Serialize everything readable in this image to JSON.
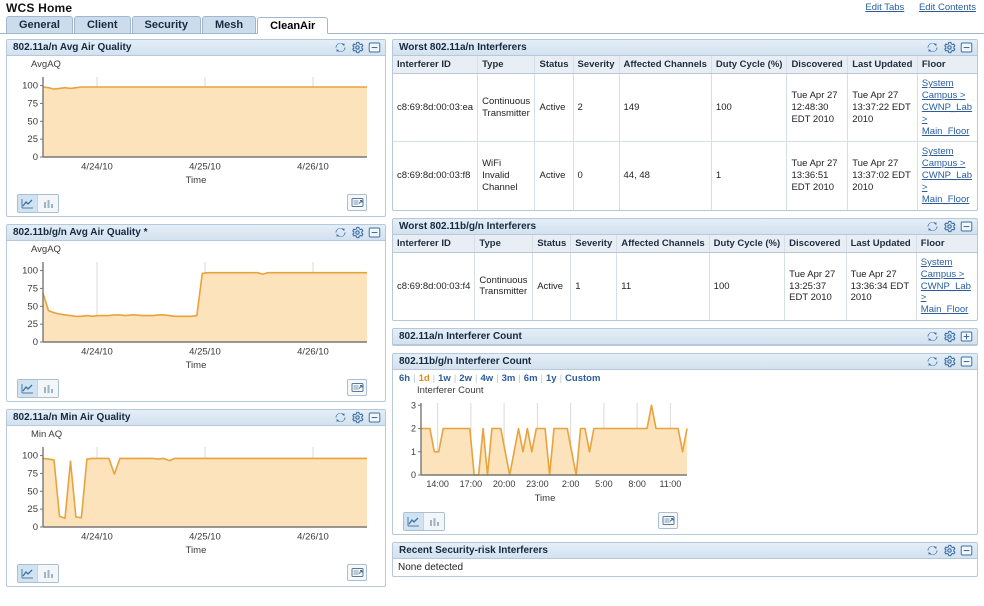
{
  "header": {
    "title": "WCS Home",
    "links": [
      {
        "label": "Edit Tabs",
        "name": "edit-tabs-link"
      },
      {
        "label": "Edit Contents",
        "name": "edit-contents-link"
      }
    ]
  },
  "tabs": [
    {
      "label": "General",
      "active": false
    },
    {
      "label": "Client",
      "active": false
    },
    {
      "label": "Security",
      "active": false
    },
    {
      "label": "Mesh",
      "active": false
    },
    {
      "label": "CleanAir",
      "active": true
    }
  ],
  "icons": {
    "refresh": "refresh-icon",
    "settings": "gear-icon",
    "minimize": "minimize-icon",
    "maximize": "maximize-icon",
    "chart_view": "line-chart-icon",
    "table_view": "bar-chart-icon",
    "export": "export-icon"
  },
  "colors": {
    "series_line": "#E8A33D",
    "series_fill": "#FCE3BC",
    "panel_header_bg": "#DCE9F5",
    "link": "#2A5D9E",
    "selected_range": "#E08A1E"
  },
  "panels": {
    "avg_aq_a": {
      "title": "802.11a/n Avg Air Quality",
      "collapsed": false
    },
    "avg_aq_bg": {
      "title": "802.11b/g/n Avg Air Quality *",
      "collapsed": false
    },
    "min_aq_a": {
      "title": "802.11a/n Min Air Quality",
      "collapsed": false
    },
    "worst_a": {
      "title": "Worst 802.11a/n Interferers",
      "collapsed": false
    },
    "worst_bg": {
      "title": "Worst 802.11b/g/n Interferers",
      "collapsed": false
    },
    "count_a": {
      "title": "802.11a/n Interferer Count",
      "collapsed": true
    },
    "count_bg": {
      "title": "802.11b/g/n Interferer Count",
      "collapsed": false
    },
    "security_risk": {
      "title": "Recent Security-risk Interferers",
      "body": "None detected"
    }
  },
  "range_selector": {
    "options": [
      "6h",
      "1d",
      "1w",
      "2w",
      "4w",
      "3m",
      "6m",
      "1y",
      "Custom"
    ],
    "selected": "1d"
  },
  "tables": {
    "columns": [
      "Interferer ID",
      "Type",
      "Status",
      "Severity",
      "Affected Channels",
      "Duty Cycle (%)",
      "Discovered",
      "Last Updated",
      "Floor"
    ],
    "worst_a_rows": [
      {
        "id": "c8:69:8d:00:03:ea",
        "type": "Continuous Transmitter",
        "status": "Active",
        "severity": "2",
        "channels": "149",
        "duty": "100",
        "discovered": "Tue Apr 27 12:48:30 EDT 2010",
        "updated": "Tue Apr 27 13:37:22 EDT 2010",
        "floor": "System Campus > CWNP_Lab > Main_Floor"
      },
      {
        "id": "c8:69:8d:00:03:f8",
        "type": "WiFi Invalid Channel",
        "status": "Active",
        "severity": "0",
        "channels": "44, 48",
        "duty": "1",
        "discovered": "Tue Apr 27 13:36:51 EDT 2010",
        "updated": "Tue Apr 27 13:37:02 EDT 2010",
        "floor": "System Campus > CWNP_Lab > Main_Floor"
      }
    ],
    "worst_bg_rows": [
      {
        "id": "c8:69:8d:00:03:f4",
        "type": "Continuous Transmitter",
        "status": "Active",
        "severity": "1",
        "channels": "11",
        "duty": "100",
        "discovered": "Tue Apr 27 13:25:37 EDT 2010",
        "updated": "Tue Apr 27 13:36:34 EDT 2010",
        "floor": "System Campus > CWNP_Lab > Main_Floor"
      }
    ]
  },
  "chart_data": [
    {
      "id": "avg_aq_a",
      "type": "area",
      "title": "802.11a/n Avg Air Quality",
      "ylabel": "AvgAQ",
      "xlabel": "Time",
      "ylim": [
        0,
        112
      ],
      "yticks": [
        0,
        25,
        50,
        75,
        100
      ],
      "xticks": [
        "4/24/10",
        "4/25/10",
        "4/26/10"
      ],
      "grid": true,
      "series": [
        {
          "name": "AvgAQ",
          "values": [
            98,
            97,
            95,
            96,
            97,
            96,
            97,
            98,
            98,
            98,
            98,
            98,
            98,
            98,
            98,
            98,
            98,
            98,
            98,
            98,
            98,
            98,
            98,
            98,
            98,
            98,
            98,
            98,
            98,
            98,
            98,
            98,
            98,
            98,
            98,
            98,
            98,
            98,
            98,
            98,
            98,
            98,
            98,
            98,
            98,
            98,
            98,
            98,
            98,
            98,
            98,
            98,
            98,
            98,
            98,
            98,
            98,
            98,
            98,
            98
          ]
        }
      ]
    },
    {
      "id": "avg_aq_bg",
      "type": "area",
      "title": "802.11b/g/n Avg Air Quality *",
      "ylabel": "AvgAQ",
      "xlabel": "Time",
      "ylim": [
        0,
        112
      ],
      "yticks": [
        0,
        25,
        50,
        75,
        100
      ],
      "xticks": [
        "4/24/10",
        "4/25/10",
        "4/26/10"
      ],
      "grid": true,
      "series": [
        {
          "name": "AvgAQ",
          "values": [
            68,
            44,
            41,
            39,
            38,
            37,
            36,
            36,
            37,
            36,
            37,
            37,
            37,
            38,
            38,
            37,
            38,
            38,
            37,
            37,
            37,
            38,
            38,
            37,
            36,
            36,
            36,
            36,
            37,
            96,
            97,
            97,
            97,
            97,
            97,
            97,
            97,
            97,
            97,
            97,
            95,
            97,
            97,
            97,
            97,
            97,
            97,
            97,
            97,
            97,
            97,
            97,
            97,
            97,
            97,
            97,
            97,
            97,
            97,
            97
          ]
        }
      ]
    },
    {
      "id": "min_aq_a",
      "type": "area",
      "title": "802.11a/n Min Air Quality",
      "ylabel": "Min AQ",
      "xlabel": "Time",
      "ylim": [
        0,
        112
      ],
      "yticks": [
        0,
        25,
        50,
        75,
        100
      ],
      "xticks": [
        "4/24/10",
        "4/25/10",
        "4/26/10"
      ],
      "grid": true,
      "series": [
        {
          "name": "MinAQ",
          "values": [
            96,
            95,
            94,
            15,
            12,
            92,
            14,
            13,
            95,
            96,
            96,
            96,
            96,
            74,
            96,
            96,
            96,
            96,
            96,
            96,
            96,
            95,
            96,
            93,
            96,
            96,
            96,
            96,
            96,
            96,
            96,
            96,
            96,
            96,
            96,
            96,
            96,
            96,
            96,
            96,
            96,
            96,
            96,
            96,
            96,
            96,
            96,
            96,
            96,
            96,
            96,
            96,
            96,
            96,
            96,
            96,
            96,
            96,
            96,
            96
          ]
        }
      ]
    },
    {
      "id": "count_bg",
      "type": "area",
      "title": "802.11b/g/n Interferer Count",
      "ylabel": "Interferer Count",
      "xlabel": "Time",
      "ylim": [
        0,
        3.1
      ],
      "yticks": [
        0,
        1,
        2,
        3
      ],
      "xticks": [
        "14:00",
        "17:00",
        "20:00",
        "23:00",
        "2:00",
        "5:00",
        "8:00",
        "11:00"
      ],
      "grid": true,
      "series": [
        {
          "name": "Interferer Count",
          "values": [
            2,
            2,
            2,
            1,
            1,
            2,
            2,
            2,
            2,
            2,
            2,
            2,
            0,
            0,
            2,
            0,
            2,
            2,
            2,
            1,
            0,
            1,
            2,
            1,
            2,
            1,
            2,
            2,
            2,
            0,
            2,
            2,
            2,
            2,
            1,
            0,
            2,
            2,
            1,
            2,
            2,
            2,
            2,
            2,
            2,
            2,
            2,
            2,
            2,
            2,
            2,
            2,
            3,
            2,
            2,
            2,
            2,
            2,
            2,
            1,
            2
          ]
        }
      ]
    }
  ]
}
